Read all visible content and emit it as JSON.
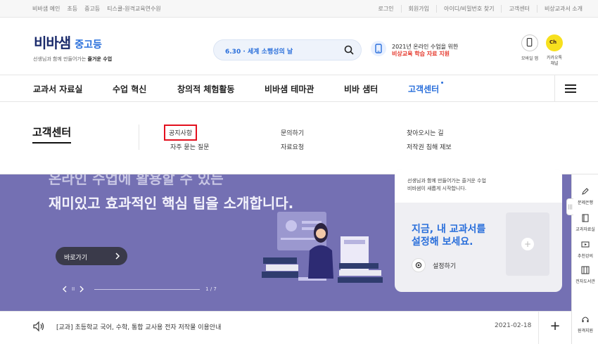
{
  "topbar": {
    "left": [
      "비바샘 예인",
      "초등",
      "중고등",
      "티스쿨-원격교육연수원"
    ],
    "right": [
      "로그인",
      "회원가입",
      "아이디/비밀번호 찾기",
      "고객센터",
      "비상교과서 소개"
    ]
  },
  "header": {
    "logo_text": "비바샘",
    "logo_sub": "중고등",
    "tagline_pre": "선생님과 함께 만들어가는 ",
    "tagline_bold": "즐거운 수업",
    "search_date": "6.30",
    "search_text": "세계 소행성의 날",
    "promo_line1": "2021년 온라인 수업을 위한",
    "promo_line2": "비상교육 학습 자료 지원",
    "mobile_label": "모바일 앱",
    "kakao_label1": "카카오톡",
    "kakao_label2": "채널",
    "kakao_ch": "Ch"
  },
  "nav": {
    "items": [
      "교과서 자료실",
      "수업 혁신",
      "창의적 체험활동",
      "비바샘 테마관",
      "비바 샘터",
      "고객센터"
    ]
  },
  "dropdown": {
    "title": "고객센터",
    "col1": [
      "공지사항",
      "자주 묻는 질문"
    ],
    "col2": [
      "문의하기",
      "자료요청"
    ],
    "col3": [
      "찾아오시는 길",
      "저작권 침해 제보"
    ]
  },
  "hero": {
    "line1": "온라인 수업에 활용할 수 있는",
    "line2": "재미있고 효과적인 핵심 팁을 소개합니다.",
    "button": "바로가기",
    "pause": "II",
    "page": "1 / 7"
  },
  "card": {
    "t1": "선생님과 함께 만들어가는 즐거운 수업",
    "t2": "비바샘이 새롭게 시작합니다.",
    "big1": "지금, 내 교과서를",
    "big2": "설정해 보세요.",
    "setting": "설정하기"
  },
  "notice": {
    "text": "[교과] 초등학교 국어, 수학, 통합 교사용 전자 저작물 이용안내",
    "date": "2021-02-18",
    "plus": "+"
  },
  "quick": {
    "handle": "|||",
    "items": [
      "문제은행",
      "교과자료실",
      "추천강의",
      "전자도서관",
      "원격지원"
    ]
  },
  "colors": {
    "accent": "#2a6fdb",
    "hero_bg": "#7470b3",
    "highlight": "#e3101e",
    "promo_red": "#e5372b"
  }
}
